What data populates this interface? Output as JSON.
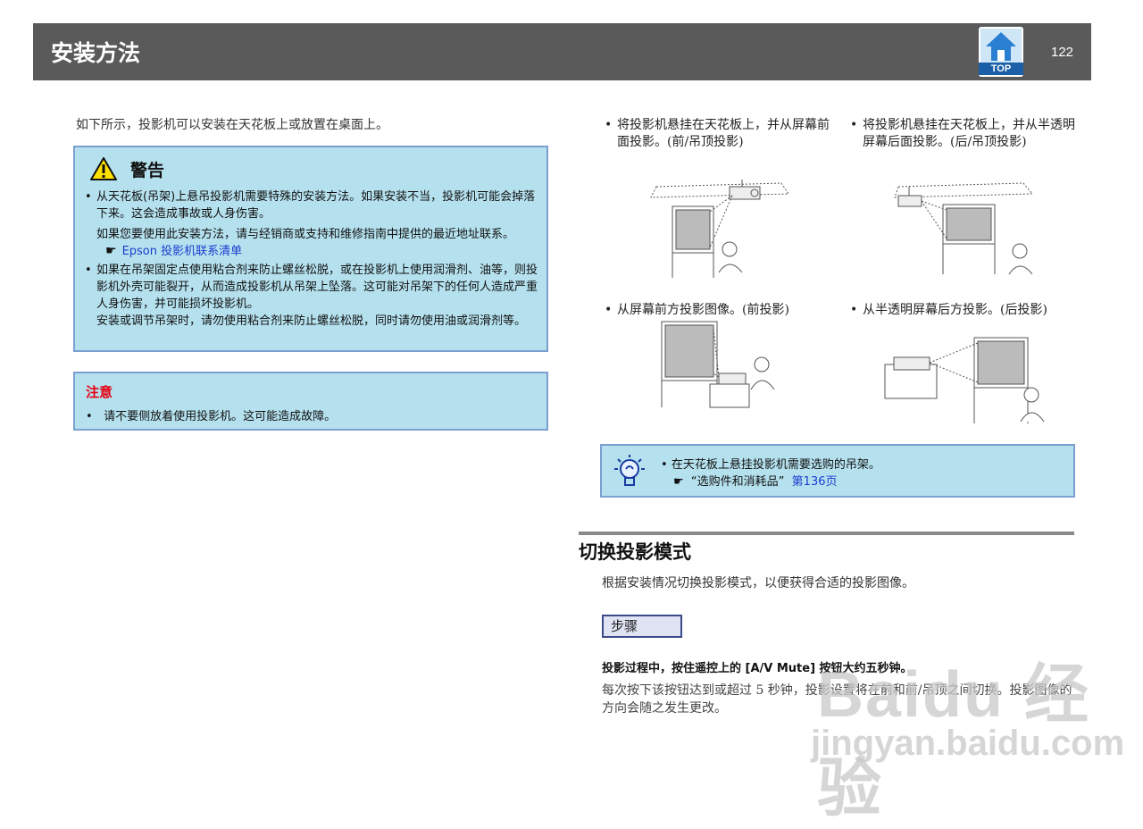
{
  "header": {
    "title": "安装方法",
    "top_label": "TOP",
    "page_number": "122"
  },
  "intro": "如下所示，投影机可以安装在天花板上或放置在桌面上。",
  "warning": {
    "title": "警告",
    "items": [
      {
        "text": "从天花板(吊架)上悬吊投影机需要特殊的安装方法。如果安装不当，投影机可能会掉落下来。这会造成事故或人身伤害。",
        "sub_text": "如果您要使用此安装方法，请与经销商或支持和维修指南中提供的最近地址联系。",
        "link": "Epson 投影机联系清单"
      },
      {
        "text": "如果在吊架固定点使用粘合剂来防止螺丝松脱，或在投影机上使用润滑剂、油等，则投影机外壳可能裂开，从而造成投影机从吊架上坠落。这可能对吊架下的任何人造成严重人身伤害，并可能损坏投影机。",
        "sub_text": "安装或调节吊架时，请勿使用粘合剂来防止螺丝松脱，同时请勿使用油或润滑剂等。"
      }
    ]
  },
  "caution": {
    "title": "注意",
    "item": "请不要侧放着使用投影机。这可能造成故障。"
  },
  "figures": [
    {
      "caption": "将投影机悬挂在天花板上，并从屏幕前面投影。(前/吊顶投影)"
    },
    {
      "caption": "将投影机悬挂在天花板上，并从半透明屏幕后面投影。(后/吊顶投影)"
    },
    {
      "caption": "从屏幕前方投影图像。(前投影)"
    },
    {
      "caption": "从半透明屏幕后方投影。(后投影)"
    }
  ],
  "tip": {
    "text": "在天花板上悬挂投影机需要选购的吊架。",
    "ref": "“选购件和消耗品”",
    "page_link": "第136页"
  },
  "section": {
    "title": "切换投影模式",
    "intro": "根据安装情况切换投影模式，以便获得合适的投影图像。",
    "step_label": "步骤",
    "step_main": "投影过程中，按住遥控上的 [A/V Mute] 按钮大约五秒钟。",
    "step_desc": "每次按下该按钮达到或超过 5 秒钟，投影设置将在前和前/吊顶之间切换。投影图像的方向会随之发生更改。"
  },
  "watermark": {
    "line1": "Baidu 经验",
    "line2": "jingyan.baidu.com"
  },
  "colors": {
    "header_bg": "#5a5a5a",
    "box_bg": "#b5e1ee",
    "box_border": "#7a9fd0",
    "caution_red": "#e60012",
    "link_blue": "#1a3ccf"
  }
}
